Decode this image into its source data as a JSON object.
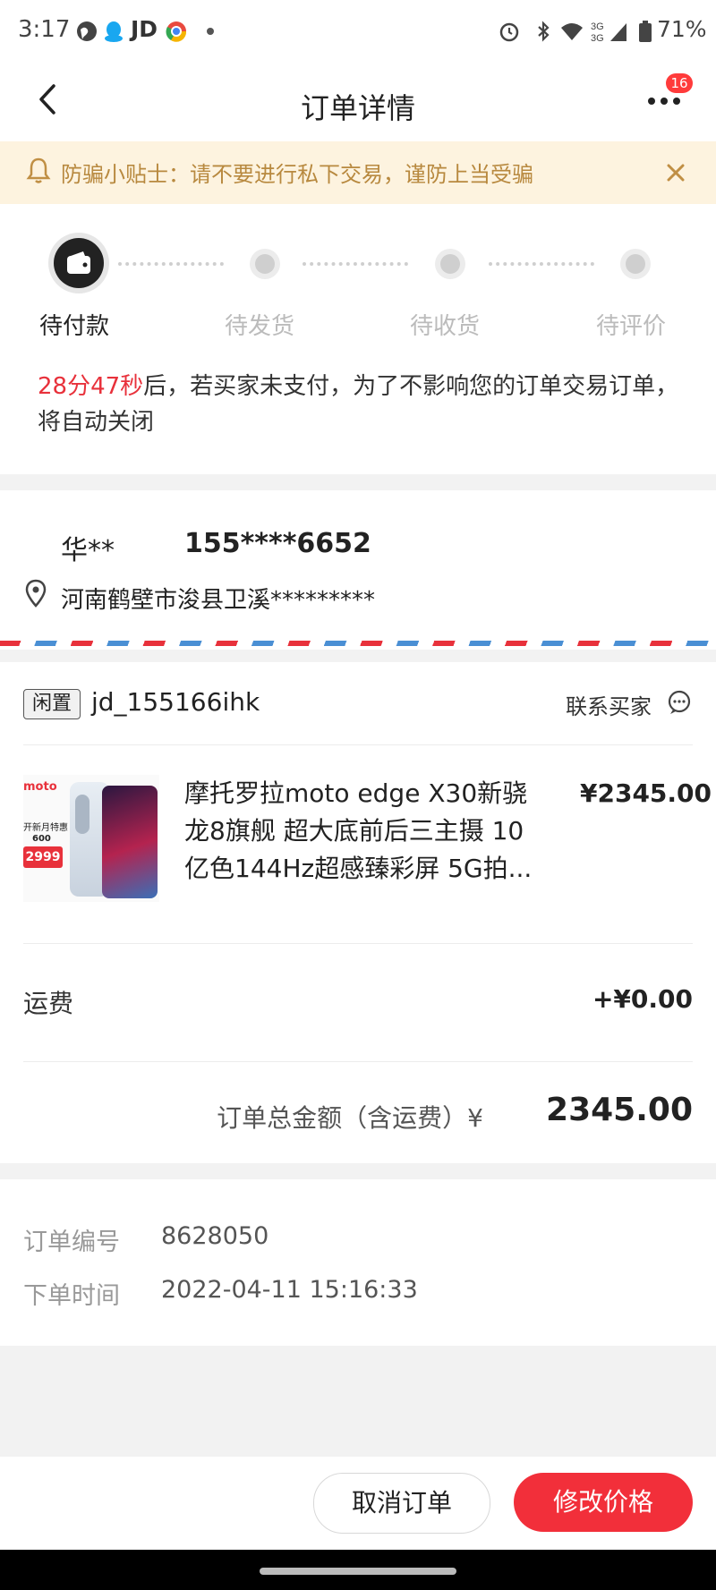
{
  "status_bar": {
    "time": "3:17",
    "carrier_text": "JD",
    "right_text": "71%",
    "icons": [
      "globe-icon",
      "qq-icon",
      "jd-icon",
      "chrome-icon",
      "dot-icon",
      "alarm-icon",
      "bluetooth-icon",
      "wifi-icon",
      "signal-icon",
      "battery-icon"
    ]
  },
  "nav": {
    "title": "订单详情",
    "more_badge": "16"
  },
  "notice": {
    "text": "防骗小贴士：请不要进行私下交易，谨防上当受骗"
  },
  "progress": {
    "steps": [
      {
        "label": "待付款",
        "active": true
      },
      {
        "label": "待发货",
        "active": false
      },
      {
        "label": "待收货",
        "active": false
      },
      {
        "label": "待评价",
        "active": false
      }
    ],
    "countdown_time": "28分47秒",
    "countdown_text": "后，若买家未支付，为了不影响您的订单交易订单，将自动关闭"
  },
  "address": {
    "name": "华**",
    "phone": "155****6652",
    "detail": "河南鹤壁市浚县卫溪*********"
  },
  "order": {
    "shop_tag": "闲置",
    "shop_name": "jd_155166ihk",
    "contact_label": "联系买家",
    "product_title": "摩托罗拉moto edge X30新骁龙8旗舰 超大底前后三主摄 10亿色144Hz超感臻彩屏 5G拍...",
    "product_price": "¥2345.00",
    "product_image_text": {
      "brand": "moto",
      "promo": "开新月特惠",
      "discount": "600",
      "price": "2999"
    },
    "shipping_label": "运费",
    "shipping_value": "+¥0.00",
    "total_label": "订单总金额（含运费）",
    "total_currency": "¥",
    "total_value": "2345.00"
  },
  "meta": {
    "order_no_label": "订单编号",
    "order_no": "8628050",
    "order_time_label": "下单时间",
    "order_time": "2022-04-11 15:16:33"
  },
  "actions": {
    "cancel_label": "取消订单",
    "modify_price_label": "修改价格"
  },
  "colors": {
    "accent": "#f22f3a",
    "notice_bg": "#fdf3df",
    "notice_text": "#b8893f"
  }
}
